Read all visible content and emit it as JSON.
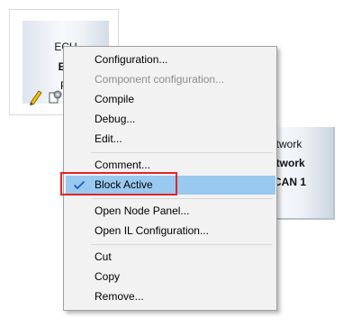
{
  "ecu_node": {
    "line1": "ECU",
    "line2": "EC",
    "line3": "Pr",
    "icons": [
      "pencil-icon",
      "gear-document-icon"
    ]
  },
  "network_node": {
    "line1": "etwork",
    "line2": "etwork",
    "line3": "CAN 1"
  },
  "context_menu": {
    "items": [
      {
        "label": "Configuration...",
        "enabled": true
      },
      {
        "label": "Component configuration...",
        "enabled": false
      },
      {
        "label": "Compile",
        "enabled": true
      },
      {
        "label": "Debug...",
        "enabled": true
      },
      {
        "label": "Edit...",
        "enabled": true
      },
      {
        "label": "Comment...",
        "enabled": true
      },
      {
        "label": "Block Active",
        "enabled": true,
        "checked": true,
        "highlighted": true
      },
      {
        "label": "Open Node Panel...",
        "enabled": true
      },
      {
        "label": "Open IL Configuration...",
        "enabled": true
      },
      {
        "label": "Cut",
        "enabled": true
      },
      {
        "label": "Copy",
        "enabled": true
      },
      {
        "label": "Remove...",
        "enabled": true
      }
    ]
  },
  "colors": {
    "hover_background": "#99c9ef",
    "annotation_border": "#e0242b",
    "check_color": "#1e5fb5"
  }
}
